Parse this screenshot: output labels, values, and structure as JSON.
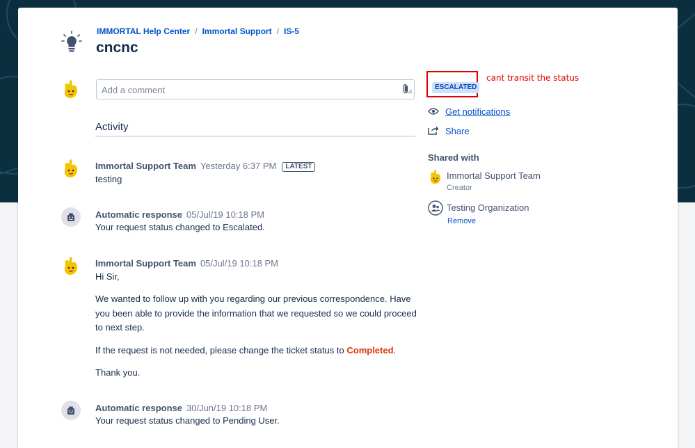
{
  "breadcrumb": [
    "IMMORTAL Help Center",
    "Immortal Support",
    "IS-5"
  ],
  "breadcrumb_separator": "/",
  "title": "cncnc",
  "comment": {
    "placeholder": "Add a comment",
    "value": ""
  },
  "activity_heading": "Activity",
  "activity": [
    {
      "author": "Immortal Support Team",
      "time": "Yesterday 6:37 PM",
      "badge": "LATEST",
      "avatar": "yellow-hand-avatar",
      "lines": [
        "testing"
      ]
    },
    {
      "author": "Automatic response",
      "time": "05/Jul/19 10:18 PM",
      "avatar": "robot-icon",
      "lines": [
        "Your request status changed to Escalated."
      ]
    },
    {
      "author": "Immortal Support Team",
      "time": "05/Jul/19 10:18 PM",
      "avatar": "yellow-hand-avatar",
      "greeting": "Hi Sir,",
      "paragraph1": "We wanted to follow up with you regarding our previous correspondence. Have you been able to provide the information that we requested so we could proceed to next step.",
      "paragraph2_prefix": "If the request is not needed, please change the ticket status to ",
      "paragraph2_emphasis": "Completed",
      "paragraph2_suffix": ".",
      "closing": "Thank you."
    },
    {
      "author": "Automatic response",
      "time": "30/Jun/19 10:18 PM",
      "avatar": "robot-icon",
      "lines": [
        "Your request status changed to Pending User."
      ]
    }
  ],
  "sidebar": {
    "status": "ESCALATED",
    "annotation": "cant transit the status",
    "get_notifications": "Get notifications",
    "share": "Share",
    "shared_with_title": "Shared with",
    "shared_with": [
      {
        "name": "Immortal Support Team",
        "sub": "Creator",
        "icon": "yellow-hand-avatar"
      },
      {
        "name": "Testing Organization",
        "sub": "Remove",
        "icon": "organization-icon"
      }
    ]
  },
  "colors": {
    "banner": "#0c2f3f",
    "link": "#0052cc",
    "status_bg": "#cce0ff",
    "annotation": "#e00000",
    "emphasis": "#de350b"
  }
}
